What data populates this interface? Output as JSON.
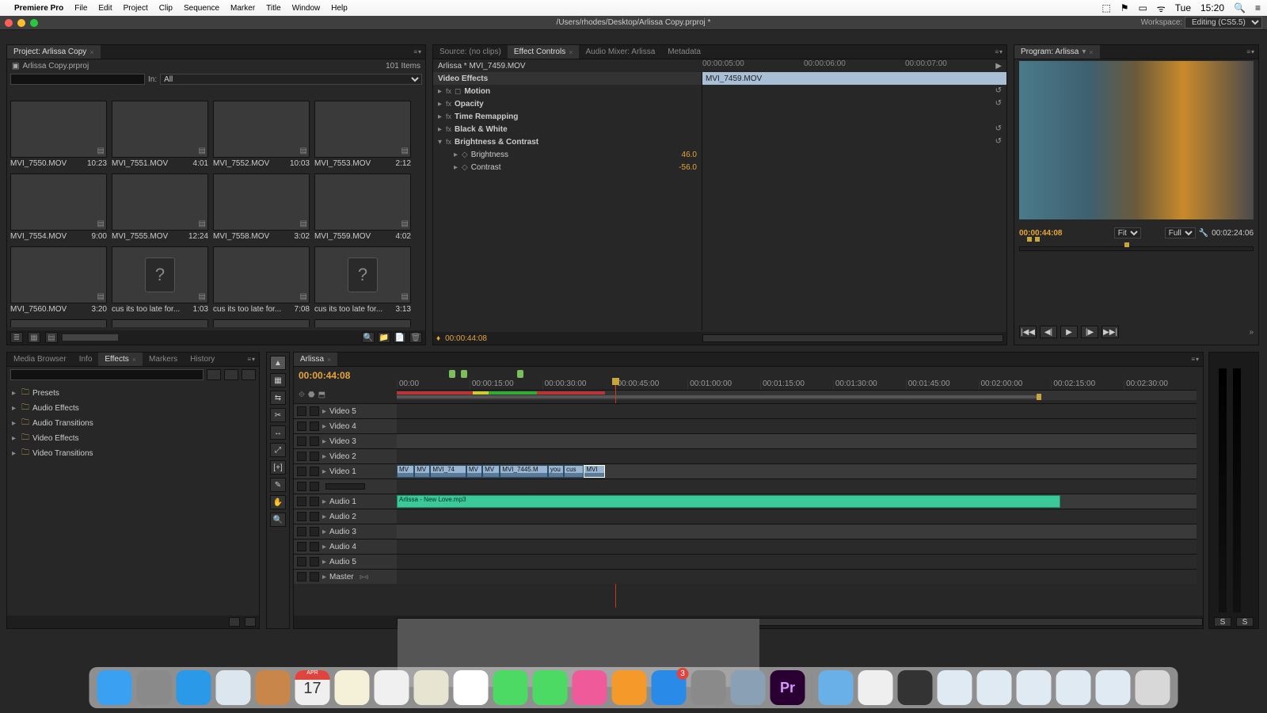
{
  "menubar": {
    "app": "Premiere Pro",
    "items": [
      "File",
      "Edit",
      "Project",
      "Clip",
      "Sequence",
      "Marker",
      "Title",
      "Window",
      "Help"
    ],
    "right": {
      "day": "Tue",
      "time": "15:20"
    }
  },
  "titlebar": {
    "path": "/Users/rhodes/Desktop/Arlissa Copy.prproj *",
    "workspace_label": "Workspace:",
    "workspace_value": "Editing (CS5.5)"
  },
  "project": {
    "tab": "Project: Arlissa Copy",
    "subtitle": "Arlissa Copy.prproj",
    "items_label": "101 Items",
    "in_label": "In:",
    "in_value": "All",
    "search_placeholder": "",
    "thumbs": [
      {
        "name": "MVI_7550.MOV",
        "dur": "10:23"
      },
      {
        "name": "MVI_7551.MOV",
        "dur": "4:01"
      },
      {
        "name": "MVI_7552.MOV",
        "dur": "10:03"
      },
      {
        "name": "MVI_7553.MOV",
        "dur": "2:12"
      },
      {
        "name": "MVI_7554.MOV",
        "dur": "9:00"
      },
      {
        "name": "MVI_7555.MOV",
        "dur": "12:24"
      },
      {
        "name": "MVI_7558.MOV",
        "dur": "3:02"
      },
      {
        "name": "MVI_7559.MOV",
        "dur": "4:02"
      },
      {
        "name": "MVI_7560.MOV",
        "dur": "3:20"
      },
      {
        "name": "cus its too late for...",
        "dur": "1:03",
        "unknown": true
      },
      {
        "name": "cus its too late for...",
        "dur": "7:08"
      },
      {
        "name": "cus its too late for...",
        "dur": "3:13",
        "unknown": true
      },
      {
        "name": "",
        "dur": "",
        "unknown": true
      },
      {
        "name": "",
        "dur": ""
      },
      {
        "name": "",
        "dur": ""
      },
      {
        "name": "",
        "dur": ""
      }
    ]
  },
  "fxbrowser": {
    "tabs": [
      "Media Browser",
      "Info",
      "Effects",
      "Markers",
      "History"
    ],
    "active": 2,
    "folders": [
      "Presets",
      "Audio Effects",
      "Audio Transitions",
      "Video Effects",
      "Video Transitions"
    ]
  },
  "fxcontrols": {
    "tabs": [
      "Source: (no clips)",
      "Effect Controls",
      "Audio Mixer: Arlissa",
      "Metadata"
    ],
    "active": 1,
    "clip_title": "Arlissa * MVI_7459.MOV",
    "clip_name": "MVI_7459.MOV",
    "section": "Video Effects",
    "ruler": [
      "00:00:05:00",
      "00:00:06:00",
      "00:00:07:00"
    ],
    "effects": [
      {
        "name": "Motion",
        "icon": "◻",
        "reset": true
      },
      {
        "name": "Opacity",
        "reset": true
      },
      {
        "name": "Time Remapping"
      },
      {
        "name": "Black & White",
        "reset": true
      },
      {
        "name": "Brightness & Contrast",
        "expanded": true,
        "reset": true,
        "params": [
          {
            "name": "Brightness",
            "val": "46.0"
          },
          {
            "name": "Contrast",
            "val": "-56.0"
          }
        ]
      }
    ],
    "footer_tc": "00:00:44:08"
  },
  "program": {
    "tab": "Program: Arlissa",
    "tc": "00:00:44:08",
    "fit": "Fit",
    "quality": "Full",
    "dur": "00:02:24:06",
    "transport": [
      "|◀◀",
      "◀|",
      "▶",
      "|▶",
      "▶▶|"
    ]
  },
  "tools": [
    "▲",
    "▦",
    "⇆",
    "✂",
    "↔",
    "⤢",
    "[+]",
    "✎",
    "✋",
    "🔍"
  ],
  "timeline": {
    "tab": "Arlissa",
    "tc": "00:00:44:08",
    "ruler": [
      "00:00",
      "00:00:15:00",
      "00:00:30:00",
      "00:00:45:00",
      "00:01:00:00",
      "00:01:15:00",
      "00:01:30:00",
      "00:01:45:00",
      "00:02:00:00",
      "00:02:15:00",
      "00:02:30:00"
    ],
    "video_tracks": [
      "Video 5",
      "Video 4",
      "Video 3",
      "Video 2",
      "Video 1"
    ],
    "audio_tracks": [
      "Audio 1",
      "Audio 2",
      "Audio 3",
      "Audio 4",
      "Audio 5",
      "Master"
    ],
    "clips_v1": [
      {
        "l": 0,
        "w": 2.2,
        "lbl": "MV"
      },
      {
        "l": 2.2,
        "w": 2.0,
        "lbl": "MV"
      },
      {
        "l": 4.2,
        "w": 4.5,
        "lbl": "MVI_74"
      },
      {
        "l": 8.7,
        "w": 2.0,
        "lbl": "MV"
      },
      {
        "l": 10.7,
        "w": 2.2,
        "lbl": "MV"
      },
      {
        "l": 12.9,
        "w": 6.0,
        "lbl": "MVI_7445.M"
      },
      {
        "l": 18.9,
        "w": 2.0,
        "lbl": "you"
      },
      {
        "l": 20.9,
        "w": 2.5,
        "lbl": "cus"
      },
      {
        "l": 23.4,
        "w": 2.6,
        "lbl": "MVI",
        "sel": true
      }
    ],
    "audio_clip": {
      "l": 0,
      "w": 83,
      "lbl": "Arlissa - New Love.mp3"
    }
  },
  "meters": {
    "solo": "S"
  },
  "dock": {
    "apps": [
      {
        "n": "finder",
        "c": "#3aa0f2"
      },
      {
        "n": "launchpad",
        "c": "#8a8a8a"
      },
      {
        "n": "safari",
        "c": "#2a99e8"
      },
      {
        "n": "mail",
        "c": "#dce6ef"
      },
      {
        "n": "contacts",
        "c": "#c9864a"
      },
      {
        "n": "calendar",
        "c": "#efefef"
      },
      {
        "n": "notes",
        "c": "#f5f0d8"
      },
      {
        "n": "reminders",
        "c": "#f0f0f0"
      },
      {
        "n": "maps",
        "c": "#e8e4d2"
      },
      {
        "n": "photos",
        "c": "#ffffff"
      },
      {
        "n": "messages",
        "c": "#4cd964"
      },
      {
        "n": "facetime",
        "c": "#4cd964"
      },
      {
        "n": "itunes",
        "c": "#ef5a9a"
      },
      {
        "n": "ibooks",
        "c": "#f59a2a"
      },
      {
        "n": "appstore",
        "c": "#2a8ae8",
        "badge": "3"
      },
      {
        "n": "sysprefs",
        "c": "#8a8a8a"
      },
      {
        "n": "preview",
        "c": "#8aa0b5"
      },
      {
        "n": "premiere",
        "c": "#2a0033"
      }
    ],
    "right": [
      {
        "n": "downloads",
        "c": "#6ab0e8"
      },
      {
        "n": "doc1",
        "c": "#efefef"
      },
      {
        "n": "doc2",
        "c": "#333"
      },
      {
        "n": "s1",
        "c": "#dfeaf2"
      },
      {
        "n": "s2",
        "c": "#dfeaf2"
      },
      {
        "n": "s3",
        "c": "#dfeaf2"
      },
      {
        "n": "s4",
        "c": "#dfeaf2"
      },
      {
        "n": "s5",
        "c": "#dfeaf2"
      },
      {
        "n": "trash",
        "c": "#d8d8d8"
      }
    ]
  }
}
